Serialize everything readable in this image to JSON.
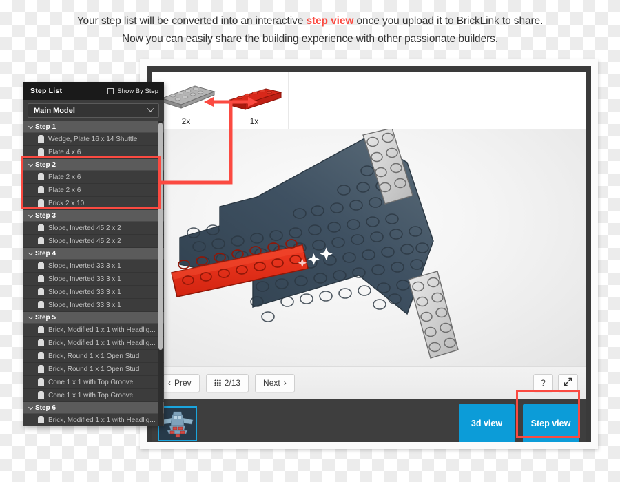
{
  "caption": {
    "line1_a": "Your step list will be converted into an interactive ",
    "line1_hl": "step view",
    "line1_b": " once you upload it to BrickLink to share.",
    "line2": "Now you can easily share the building experience with other passionate builders."
  },
  "sidebar": {
    "title": "Step List",
    "show_by_step_label": "Show By Step",
    "show_by_step_checked": false,
    "model_select_value": "Main Model",
    "chevron_icon": "chevron-down-icon",
    "steps": [
      {
        "label": "Step 1",
        "parts": [
          "Wedge, Plate 16 x 14 Shuttle",
          "Plate 4 x 6"
        ]
      },
      {
        "label": "Step 2",
        "parts": [
          "Plate 2 x 6",
          "Plate 2 x 6",
          "Brick 2 x 10"
        ]
      },
      {
        "label": "Step 3",
        "parts": [
          "Slope, Inverted 45 2 x 2",
          "Slope, Inverted 45 2 x 2"
        ]
      },
      {
        "label": "Step 4",
        "parts": [
          "Slope, Inverted 33 3 x 1",
          "Slope, Inverted 33 3 x 1",
          "Slope, Inverted 33 3 x 1",
          "Slope, Inverted 33 3 x 1"
        ]
      },
      {
        "label": "Step 5",
        "parts": [
          "Brick, Modified 1 x 1 with Headlig...",
          "Brick, Modified 1 x 1 with Headlig...",
          "Brick, Round 1 x 1 Open Stud",
          "Brick, Round 1 x 1 Open Stud",
          "Cone 1 x 1 with Top Groove",
          "Cone 1 x 1 with Top Groove"
        ]
      },
      {
        "label": "Step 6",
        "parts": [
          "Brick, Modified 1 x 1 with Headlig..."
        ]
      }
    ]
  },
  "parts_strip": [
    {
      "qty": "2x",
      "art": "gray-plate",
      "color": "#a9a9a9"
    },
    {
      "qty": "1x",
      "art": "red-brick",
      "color": "#cc1f11"
    }
  ],
  "navbar": {
    "prev_label": "Prev",
    "prev_icon": "chevron-left-icon",
    "page_label": "2/13",
    "page_icon": "grid-icon",
    "next_label": "Next",
    "next_icon": "chevron-right-icon",
    "help_label": "?",
    "help_icon": "question-mark-icon",
    "expand_icon": "expand-arrows-icon"
  },
  "footer": {
    "thumbnail_name": "shuttle-model-thumbnail",
    "btn_3d_label": "3d view",
    "btn_step_label": "Step view"
  },
  "colors": {
    "accent_red": "#fb4a41",
    "button_blue": "#0c9cd8",
    "model_dark": "#3d4d5c",
    "model_red": "#e8331c",
    "model_gray": "#d3d3d3",
    "frame_dark": "#3a3a3a",
    "sidebar_bg": "#3c3c3c",
    "step_header_bg": "#5b5b5b"
  }
}
